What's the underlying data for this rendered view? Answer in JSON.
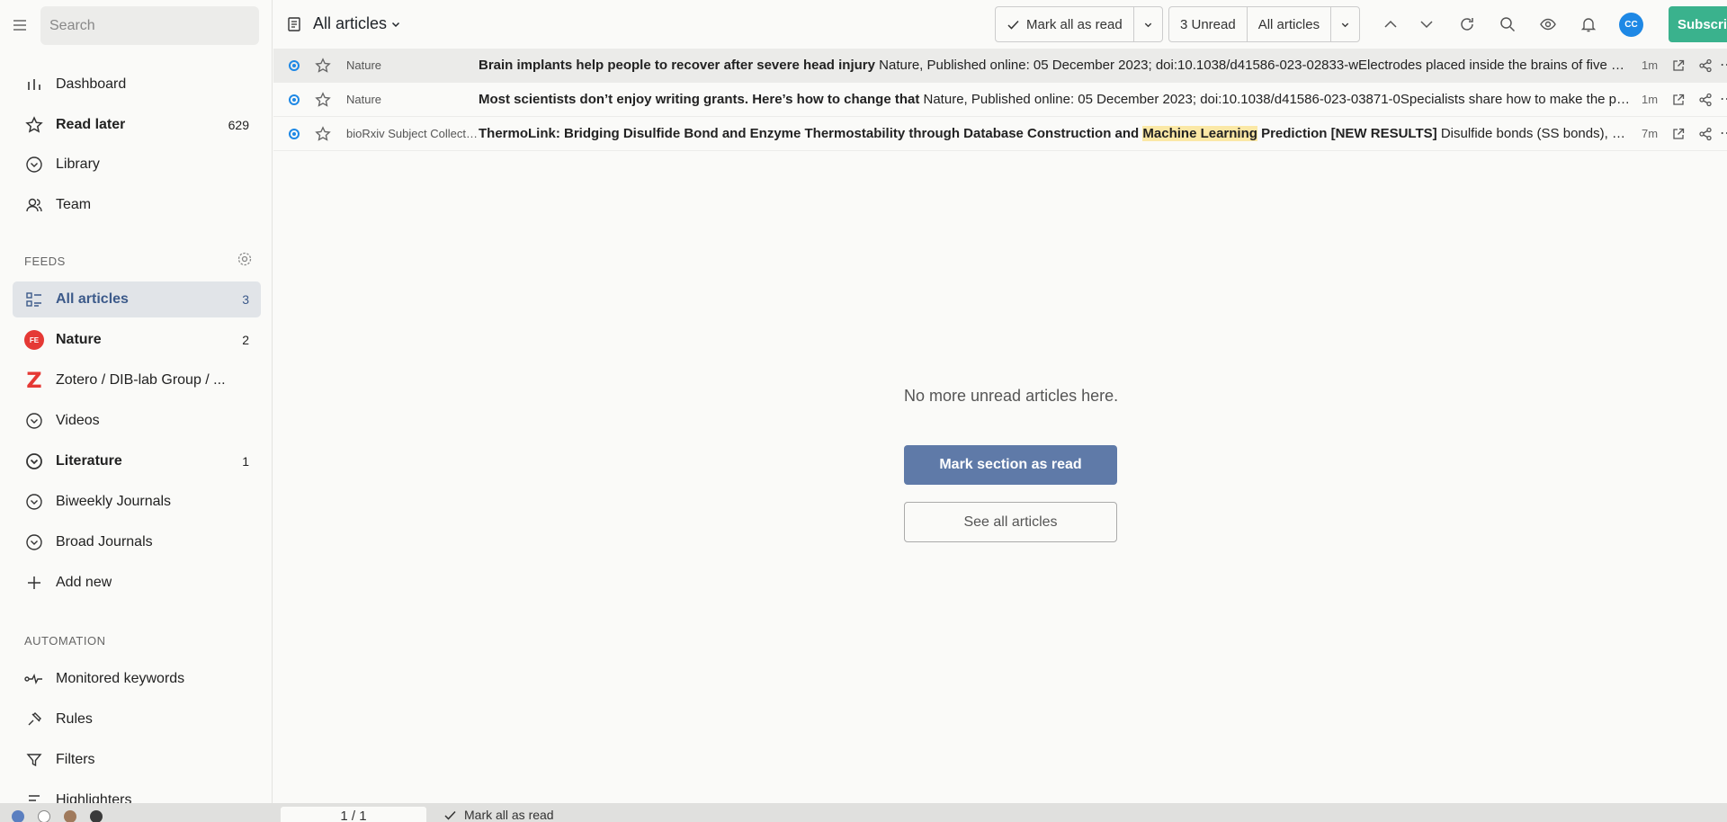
{
  "search": {
    "placeholder": "Search"
  },
  "sidebar": {
    "main_items": [
      {
        "label": "Dashboard"
      },
      {
        "label": "Read later",
        "count": "629"
      },
      {
        "label": "Library"
      },
      {
        "label": "Team"
      }
    ],
    "feeds_title": "FEEDS",
    "feeds": [
      {
        "label": "All articles",
        "count": "3",
        "active": true
      },
      {
        "label": "Nature",
        "count": "2",
        "badge": "FE"
      },
      {
        "label": "Zotero / DIB-lab Group / ...",
        "logo": "Z"
      },
      {
        "label": "Videos"
      },
      {
        "label": "Literature",
        "count": "1"
      },
      {
        "label": "Biweekly Journals"
      },
      {
        "label": "Broad Journals"
      },
      {
        "label": "Add new"
      }
    ],
    "automation_title": "AUTOMATION",
    "automation": [
      {
        "label": "Monitored keywords"
      },
      {
        "label": "Rules"
      },
      {
        "label": "Filters"
      },
      {
        "label": "Highlighters"
      }
    ]
  },
  "header": {
    "title": "All articles",
    "mark_all_read": "Mark all as read",
    "unread_count": "3 Unread",
    "filter_select": "All articles",
    "avatar_initials": "CC",
    "subscribe_label": "Subscribe"
  },
  "articles": [
    {
      "source": "Nature",
      "title": "Brain implants help people to recover after severe head injury",
      "snippet": " Nature, Published online: 05 December 2023; doi:10.1038/d41586-023-02833-wElectrodes placed inside the brains of five people with severe head injuries improved their cognition and quality of life",
      "time": "1m"
    },
    {
      "source": "Nature",
      "title": "Most scientists don’t enjoy writing grants. Here’s how to change that",
      "snippet": " Nature, Published online: 05 December 2023; doi:10.1038/d41586-023-03871-0Specialists share how to make the process of applying for funding less painful",
      "time": "1m"
    },
    {
      "source": "bioRxiv Subject Collection",
      "title_before": "ThermoLink: Bridging Disulfide Bond and Enzyme Thermostability through Database Construction and ",
      "title_highlight": "Machine Learning",
      "title_after": " Prediction [NEW RESULTS]",
      "snippet": " Disulfide bonds (SS bonds), covalent bonds formed between cysteine residues, play an important role in protein stability",
      "time": "7m"
    }
  ],
  "empty_state": {
    "message": "No more unread articles here.",
    "primary_button": "Mark section as read",
    "secondary_button": "See all articles"
  },
  "bottom": {
    "theme_colors": [
      "#5b7fc0",
      "#ffffff",
      "#a07a5c",
      "#3a3a3a"
    ],
    "pager": "1 / 1",
    "mark_all_read": "Mark all as read"
  }
}
